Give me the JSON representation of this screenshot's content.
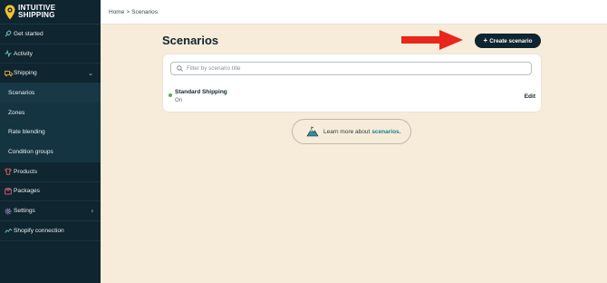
{
  "brand": {
    "line1": "INTUITIVE",
    "line2": "SHIPPING"
  },
  "colors": {
    "sidebar_bg": "#0f2530",
    "page_bg": "#f6ecd9",
    "accent": "#1a7f8c",
    "arrow": "#e8261b",
    "status_on": "#4fae5b"
  },
  "sidebar": {
    "items": [
      {
        "label": "Get started",
        "icon": "rocket-icon"
      },
      {
        "label": "Activity",
        "icon": "activity-icon"
      },
      {
        "label": "Shipping",
        "icon": "truck-icon",
        "expanded": true
      },
      {
        "label": "Products",
        "icon": "shirt-icon"
      },
      {
        "label": "Packages",
        "icon": "package-icon"
      },
      {
        "label": "Settings",
        "icon": "gear-icon"
      },
      {
        "label": "Shopify connection",
        "icon": "link-icon"
      }
    ],
    "shipping_sub": [
      {
        "label": "Scenarios",
        "active": true
      },
      {
        "label": "Zones"
      },
      {
        "label": "Rate blending"
      },
      {
        "label": "Condition groups"
      }
    ]
  },
  "breadcrumb": {
    "home": "Home",
    "separator": ">",
    "current": "Scenarios"
  },
  "page": {
    "title": "Scenarios",
    "create_label": "Create scenario"
  },
  "search": {
    "placeholder": "Filter by scenario title",
    "value": ""
  },
  "scenarios": [
    {
      "title": "Standard Shipping",
      "status": "On",
      "action": "Edit"
    }
  ],
  "learn": {
    "text": "Learn more about",
    "link": "scenarios."
  }
}
